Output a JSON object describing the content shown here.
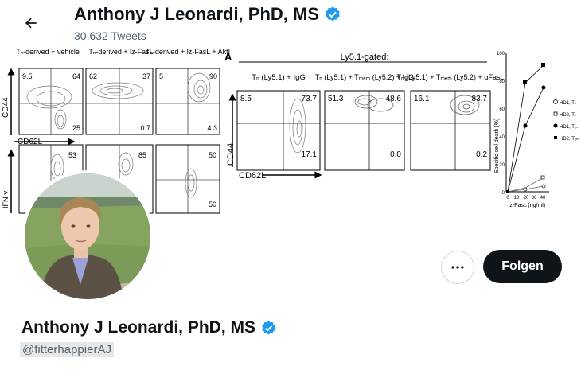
{
  "header": {
    "back_icon": "arrow-left-icon",
    "name": "Anthony J Leonardi, PhD, MS",
    "tweet_count": "30.632 Tweets"
  },
  "banner": {
    "left_panel": {
      "col_titles": [
        "Tₙ-derived + vehicle",
        "Tₙ-derived + lz-FasL",
        "Tₙ-derived + lz-FasL + AktI"
      ],
      "y_labels": [
        "CD44",
        "IFN-γ"
      ],
      "x_label": "CD62L",
      "row1_values": [
        [
          "9.5",
          "64",
          "25"
        ],
        [
          "62",
          "37",
          "0.7"
        ],
        [
          "5",
          "90",
          "4.3"
        ]
      ],
      "row2_values": [
        [
          "53"
        ],
        [
          "85"
        ],
        [
          "50",
          "50"
        ]
      ]
    },
    "middle_panel": {
      "panel_letter": "A",
      "gate_title": "Ly5.1-gated:",
      "col_titles": [
        "Tₙ (Ly5.1) + IgG",
        "Tₙ (Ly5.1) + Tₘₑₘ (Ly5.2) + IgG",
        "Tₙ (Ly5.1) + Tₘₑₘ (Ly5.2) + αFasL"
      ],
      "y_label": "CD44",
      "x_label": "CD62L",
      "plot_values": [
        [
          "8.5",
          "73.7",
          "17.1"
        ],
        [
          "51.3",
          "48.6",
          "0.0"
        ],
        [
          "16.1",
          "83.7",
          "0.2"
        ]
      ]
    },
    "right_panel": {
      "y_label": "Specific cell death (%)",
      "x_label": "lz-FasL (ng/ml)",
      "x_ticks": [
        "0",
        "10",
        "20",
        "30",
        "40"
      ],
      "y_ticks": [
        "0",
        "20",
        "40",
        "60",
        "80",
        "100"
      ],
      "legend": [
        "HD1, Tₙ",
        "HD2, Tₙ",
        "HD1, Tₑₘ",
        "HD2, Tₑₘ"
      ]
    }
  },
  "profile": {
    "name": "Anthony J Leonardi, PhD, MS",
    "handle": "@fitterhappierAJ",
    "verified_icon": "verified-badge-icon",
    "more_icon": "more-dots-icon",
    "follow_label": "Folgen"
  },
  "colors": {
    "verified": "#1d9bf0",
    "follow_bg": "#0f1419",
    "secondary_text": "#536471"
  }
}
